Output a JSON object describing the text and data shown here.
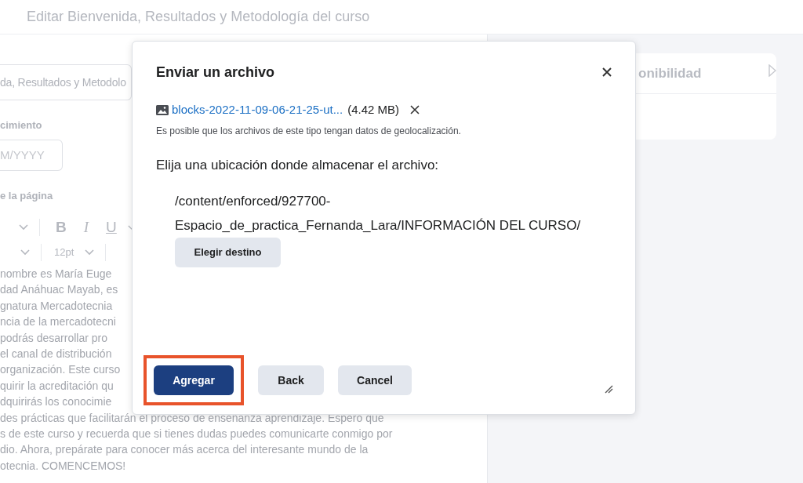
{
  "page": {
    "title": "Editar Bienvenida, Resultados y Metodología del curso"
  },
  "editor": {
    "title_field": "da, Resultados y Metodolo",
    "date_label": "cimiento",
    "date_placeholder": "M/YYYY",
    "content_label": "e la página",
    "format_buttons": [
      "B",
      "I",
      "U"
    ],
    "font_size": "12pt",
    "body_lines": [
      "nombre es María Euge",
      "dad Anáhuac Mayab, es",
      "gnatura Mercadotecnia",
      "ncia de la mercadotecni",
      "podrás desarrollar pro",
      "el canal de distribución",
      "organización. Este curso",
      "quirir la acreditación qu",
      "dquirirás los conocimie",
      "des prácticas que facilitarán el proceso de enseñanza aprendizaje. Espero que",
      "s de este curso y recuerda que si tienes dudas puedes comunicarte conmigo por",
      "dio. Ahora, prepárate para conocer más acerca del interesante mundo de la",
      "otecnia. COMENCEMOS!"
    ]
  },
  "side_panel": {
    "heading": "onibilidad"
  },
  "dialog": {
    "title": "Enviar un archivo",
    "file": {
      "name": "blocks-2022-11-09-06-21-25-ut...",
      "size": "(4.42 MB)"
    },
    "note": "Es posible que los archivos de este tipo tengan datos de geolocalización.",
    "prompt": "Elija una ubicación donde almacenar el archivo:",
    "path": "/content/enforced/927700-Espacio_de_practica_Fernanda_Lara/INFORMACIÓN DEL CURSO/",
    "choose_button": "Elegir destino",
    "buttons": [
      {
        "label": "Agregar",
        "kind": "primary",
        "highlighted": true
      },
      {
        "label": "Back",
        "kind": "secondary",
        "highlighted": false
      },
      {
        "label": "Cancel",
        "kind": "secondary",
        "highlighted": false
      }
    ]
  }
}
